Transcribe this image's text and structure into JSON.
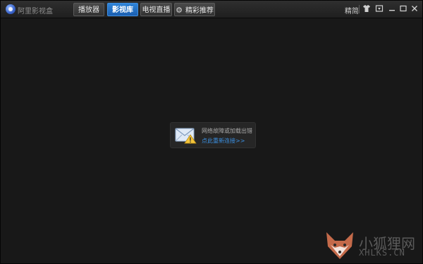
{
  "app": {
    "title": "阿里影视盒"
  },
  "tabs": [
    {
      "label": "播放器",
      "active": false
    },
    {
      "label": "影视库",
      "active": true
    },
    {
      "label": "电视直播",
      "active": false
    },
    {
      "label": "精彩推荐",
      "active": false,
      "icon": "gear-icon"
    }
  ],
  "topbar": {
    "mode_label": "精简",
    "icons": [
      "skin-icon",
      "window-mode-icon",
      "minimize-icon",
      "maximize-icon",
      "close-icon"
    ]
  },
  "error": {
    "message": "网络故障或加载出错",
    "link": "点此重新连接>>"
  },
  "watermark": {
    "cn": "小狐狸网",
    "en": "XHLKS.CN"
  },
  "colors": {
    "background": "#181818",
    "active_tab": "#1b5fb0",
    "link": "#3b8fe0"
  }
}
